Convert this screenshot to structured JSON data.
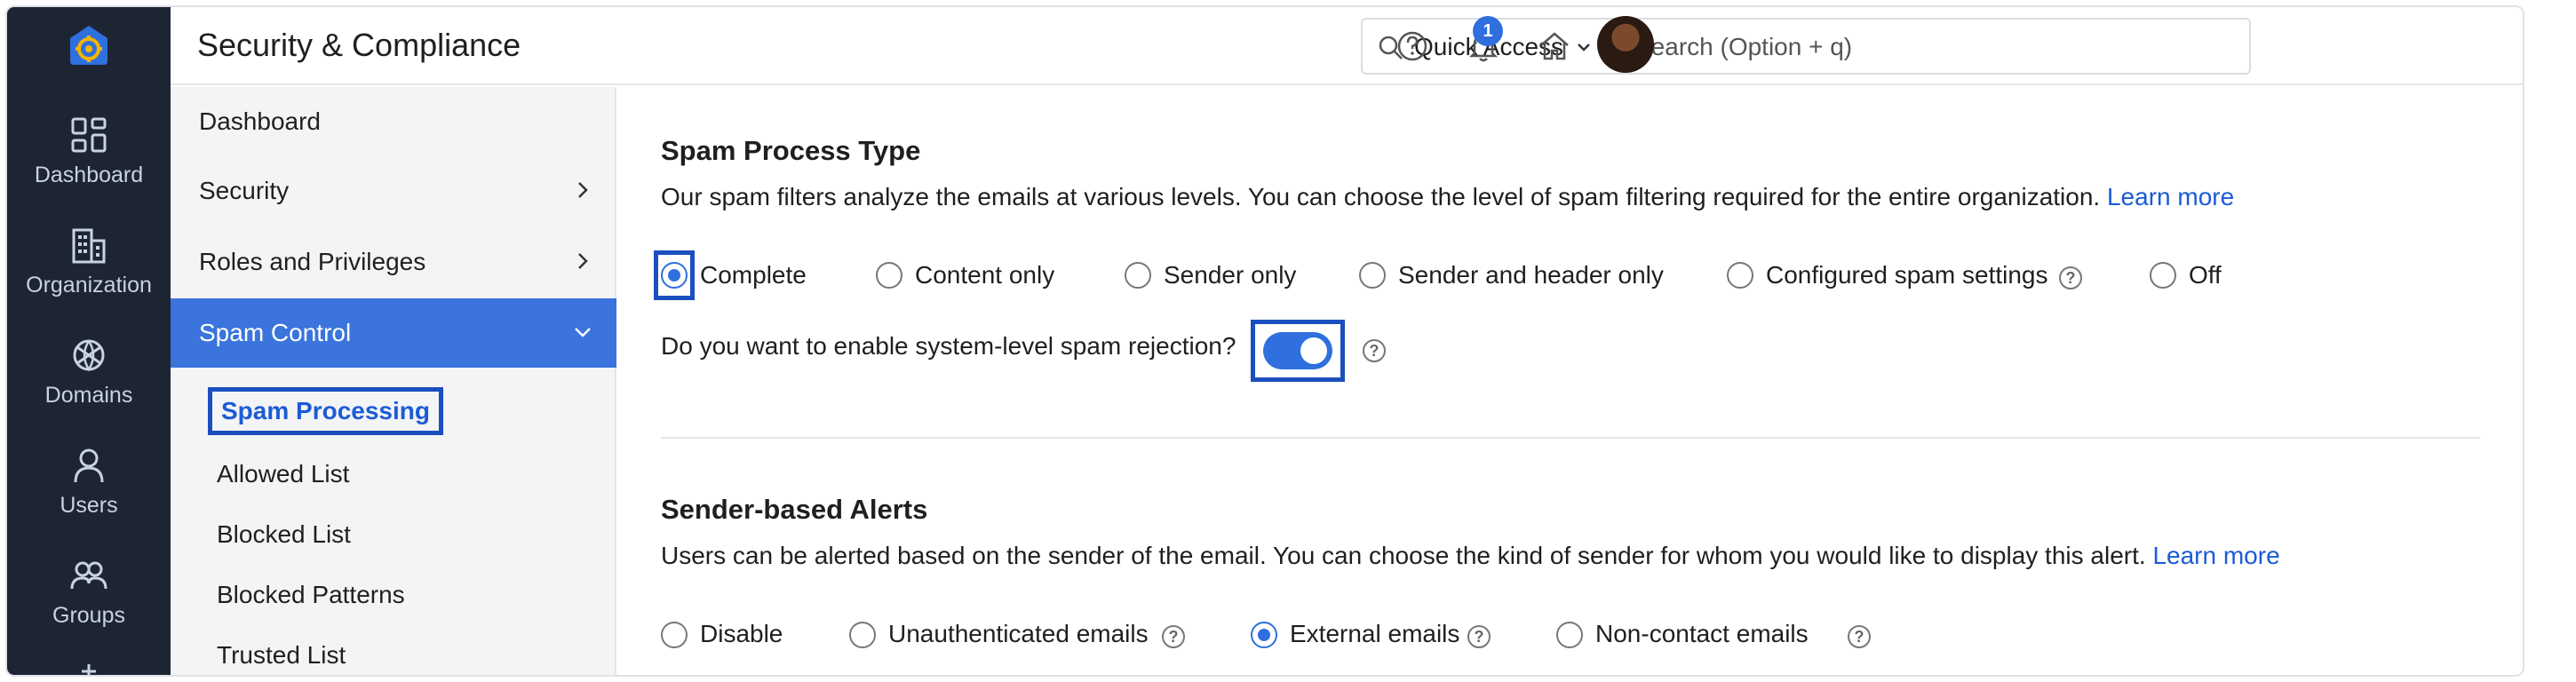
{
  "app": {
    "title": "Security & Compliance",
    "colors": {
      "rail": "#1d2533",
      "accent": "#2f6fde",
      "focus": "#1b4fc0",
      "link": "#1b5bd6"
    }
  },
  "rail": {
    "logo_icon": "gear-house-logo-icon",
    "items": [
      {
        "label": "Dashboard",
        "icon": "dashboard-grid-icon"
      },
      {
        "label": "Organization",
        "icon": "building-icon"
      },
      {
        "label": "Domains",
        "icon": "globe-icon"
      },
      {
        "label": "Users",
        "icon": "user-icon"
      },
      {
        "label": "Groups",
        "icon": "group-icon"
      }
    ]
  },
  "topbar": {
    "quick_access": "Quick Access",
    "search_placeholder": "Search (Option + q)",
    "notification_count": "1",
    "icons": [
      "help-icon",
      "bell-icon",
      "home-icon",
      "avatar"
    ]
  },
  "subnav": {
    "items": [
      {
        "label": "Dashboard"
      },
      {
        "label": "Security"
      },
      {
        "label": "Roles and Privileges"
      },
      {
        "label": "Spam Control"
      }
    ],
    "spam_children": [
      {
        "label": "Spam Processing"
      },
      {
        "label": "Allowed List"
      },
      {
        "label": "Blocked List"
      },
      {
        "label": "Blocked Patterns"
      },
      {
        "label": "Trusted List"
      }
    ]
  },
  "spam_process": {
    "title": "Spam Process Type",
    "description": "Our spam filters analyze the emails at various levels. You can choose the level of spam filtering required for the entire organization.",
    "learn_more": "Learn more",
    "options": [
      {
        "label": "Complete",
        "checked": true
      },
      {
        "label": "Content only",
        "checked": false
      },
      {
        "label": "Sender only",
        "checked": false
      },
      {
        "label": "Sender and header only",
        "checked": false
      },
      {
        "label": "Configured spam settings",
        "checked": false
      },
      {
        "label": "Off",
        "checked": false
      }
    ],
    "rejection_question": "Do you want to enable system-level spam rejection?",
    "rejection_enabled": true
  },
  "sender_alerts": {
    "title": "Sender-based Alerts",
    "description": "Users can be alerted based on the sender of the email. You can choose the kind of sender for whom you would like to display this alert.",
    "learn_more": "Learn more",
    "options": [
      {
        "label": "Disable",
        "checked": false
      },
      {
        "label": "Unauthenticated emails",
        "checked": false
      },
      {
        "label": "External emails",
        "checked": true
      },
      {
        "label": "Non-contact emails",
        "checked": false
      }
    ]
  }
}
